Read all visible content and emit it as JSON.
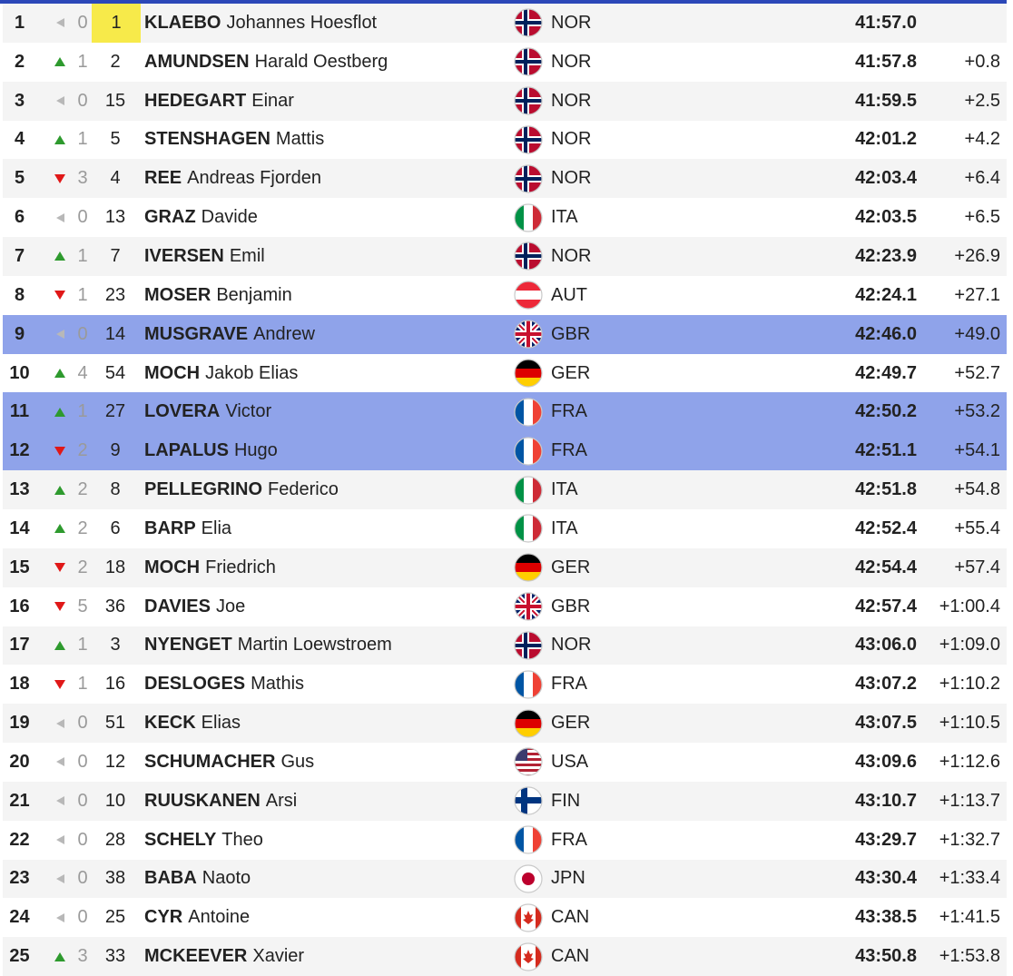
{
  "results": [
    {
      "rank": "1",
      "trend": "same",
      "change": "0",
      "bib": "1",
      "bib_gold": true,
      "last": "KLAEBO",
      "first": "Johannes Hoesflot",
      "flag": "nor-flag-icon",
      "nation": "NOR",
      "time": "41:57.0",
      "diff": "",
      "highlight": false
    },
    {
      "rank": "2",
      "trend": "up",
      "change": "1",
      "bib": "2",
      "last": "AMUNDSEN",
      "first": "Harald Oestberg",
      "flag": "nor-flag-icon",
      "nation": "NOR",
      "time": "41:57.8",
      "diff": "+0.8",
      "highlight": false
    },
    {
      "rank": "3",
      "trend": "same",
      "change": "0",
      "bib": "15",
      "last": "HEDEGART",
      "first": "Einar",
      "flag": "nor-flag-icon",
      "nation": "NOR",
      "time": "41:59.5",
      "diff": "+2.5",
      "highlight": false
    },
    {
      "rank": "4",
      "trend": "up",
      "change": "1",
      "bib": "5",
      "last": "STENSHAGEN",
      "first": "Mattis",
      "flag": "nor-flag-icon",
      "nation": "NOR",
      "time": "42:01.2",
      "diff": "+4.2",
      "highlight": false
    },
    {
      "rank": "5",
      "trend": "down",
      "change": "3",
      "bib": "4",
      "last": "REE",
      "first": "Andreas Fjorden",
      "flag": "nor-flag-icon",
      "nation": "NOR",
      "time": "42:03.4",
      "diff": "+6.4",
      "highlight": false
    },
    {
      "rank": "6",
      "trend": "same",
      "change": "0",
      "bib": "13",
      "last": "GRAZ",
      "first": "Davide",
      "flag": "ita-flag-icon",
      "nation": "ITA",
      "time": "42:03.5",
      "diff": "+6.5",
      "highlight": false
    },
    {
      "rank": "7",
      "trend": "up",
      "change": "1",
      "bib": "7",
      "last": "IVERSEN",
      "first": "Emil",
      "flag": "nor-flag-icon",
      "nation": "NOR",
      "time": "42:23.9",
      "diff": "+26.9",
      "highlight": false
    },
    {
      "rank": "8",
      "trend": "down",
      "change": "1",
      "bib": "23",
      "last": "MOSER",
      "first": "Benjamin",
      "flag": "aut-flag-icon",
      "nation": "AUT",
      "time": "42:24.1",
      "diff": "+27.1",
      "highlight": false
    },
    {
      "rank": "9",
      "trend": "same",
      "change": "0",
      "bib": "14",
      "last": "MUSGRAVE",
      "first": "Andrew",
      "flag": "gbr-flag-icon",
      "nation": "GBR",
      "time": "42:46.0",
      "diff": "+49.0",
      "highlight": true
    },
    {
      "rank": "10",
      "trend": "up",
      "change": "4",
      "bib": "54",
      "last": "MOCH",
      "first": "Jakob Elias",
      "flag": "ger-flag-icon",
      "nation": "GER",
      "time": "42:49.7",
      "diff": "+52.7",
      "highlight": false
    },
    {
      "rank": "11",
      "trend": "up",
      "change": "1",
      "bib": "27",
      "last": "LOVERA",
      "first": "Victor",
      "flag": "fra-flag-icon",
      "nation": "FRA",
      "time": "42:50.2",
      "diff": "+53.2",
      "highlight": true
    },
    {
      "rank": "12",
      "trend": "down",
      "change": "2",
      "bib": "9",
      "last": "LAPALUS",
      "first": "Hugo",
      "flag": "fra-flag-icon",
      "nation": "FRA",
      "time": "42:51.1",
      "diff": "+54.1",
      "highlight": true
    },
    {
      "rank": "13",
      "trend": "up",
      "change": "2",
      "bib": "8",
      "last": "PELLEGRINO",
      "first": "Federico",
      "flag": "ita-flag-icon",
      "nation": "ITA",
      "time": "42:51.8",
      "diff": "+54.8",
      "highlight": false
    },
    {
      "rank": "14",
      "trend": "up",
      "change": "2",
      "bib": "6",
      "last": "BARP",
      "first": "Elia",
      "flag": "ita-flag-icon",
      "nation": "ITA",
      "time": "42:52.4",
      "diff": "+55.4",
      "highlight": false
    },
    {
      "rank": "15",
      "trend": "down",
      "change": "2",
      "bib": "18",
      "last": "MOCH",
      "first": "Friedrich",
      "flag": "ger-flag-icon",
      "nation": "GER",
      "time": "42:54.4",
      "diff": "+57.4",
      "highlight": false
    },
    {
      "rank": "16",
      "trend": "down",
      "change": "5",
      "bib": "36",
      "last": "DAVIES",
      "first": "Joe",
      "flag": "gbr-flag-icon",
      "nation": "GBR",
      "time": "42:57.4",
      "diff": "+1:00.4",
      "highlight": false
    },
    {
      "rank": "17",
      "trend": "up",
      "change": "1",
      "bib": "3",
      "last": "NYENGET",
      "first": "Martin Loewstroem",
      "flag": "nor-flag-icon",
      "nation": "NOR",
      "time": "43:06.0",
      "diff": "+1:09.0",
      "highlight": false
    },
    {
      "rank": "18",
      "trend": "down",
      "change": "1",
      "bib": "16",
      "last": "DESLOGES",
      "first": "Mathis",
      "flag": "fra-flag-icon",
      "nation": "FRA",
      "time": "43:07.2",
      "diff": "+1:10.2",
      "highlight": false
    },
    {
      "rank": "19",
      "trend": "same",
      "change": "0",
      "bib": "51",
      "last": "KECK",
      "first": "Elias",
      "flag": "ger-flag-icon",
      "nation": "GER",
      "time": "43:07.5",
      "diff": "+1:10.5",
      "highlight": false
    },
    {
      "rank": "20",
      "trend": "same",
      "change": "0",
      "bib": "12",
      "last": "SCHUMACHER",
      "first": "Gus",
      "flag": "usa-flag-icon",
      "nation": "USA",
      "time": "43:09.6",
      "diff": "+1:12.6",
      "highlight": false
    },
    {
      "rank": "21",
      "trend": "same",
      "change": "0",
      "bib": "10",
      "last": "RUUSKANEN",
      "first": "Arsi",
      "flag": "fin-flag-icon",
      "nation": "FIN",
      "time": "43:10.7",
      "diff": "+1:13.7",
      "highlight": false
    },
    {
      "rank": "22",
      "trend": "same",
      "change": "0",
      "bib": "28",
      "last": "SCHELY",
      "first": "Theo",
      "flag": "fra-flag-icon",
      "nation": "FRA",
      "time": "43:29.7",
      "diff": "+1:32.7",
      "highlight": false
    },
    {
      "rank": "23",
      "trend": "same",
      "change": "0",
      "bib": "38",
      "last": "BABA",
      "first": "Naoto",
      "flag": "jpn-flag-icon",
      "nation": "JPN",
      "time": "43:30.4",
      "diff": "+1:33.4",
      "highlight": false
    },
    {
      "rank": "24",
      "trend": "same",
      "change": "0",
      "bib": "25",
      "last": "CYR",
      "first": "Antoine",
      "flag": "can-flag-icon",
      "nation": "CAN",
      "time": "43:38.5",
      "diff": "+1:41.5",
      "highlight": false
    },
    {
      "rank": "25",
      "trend": "up",
      "change": "3",
      "bib": "33",
      "last": "MCKEEVER",
      "first": "Xavier",
      "flag": "can-flag-icon",
      "nation": "CAN",
      "time": "43:50.8",
      "diff": "+1:53.8",
      "highlight": false
    }
  ],
  "colors": {
    "accent_bar": "#2b47b8",
    "highlight_row": "#8fa3ea",
    "stripe_row": "#f4f4f4",
    "bib_leader": "#f7ea4a",
    "trend_up": "#2e9a2e",
    "trend_down": "#e01818",
    "trend_same": "#b8b8b8"
  }
}
